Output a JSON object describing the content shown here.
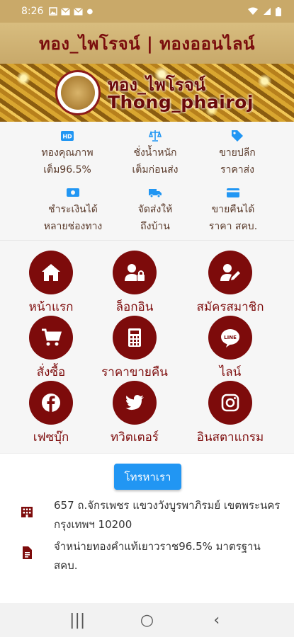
{
  "status_bar": {
    "time": "8:26",
    "notification_icons": [
      "gallery-icon",
      "mail-icon",
      "mail-icon",
      "dot-icon"
    ],
    "right_icons": [
      "wifi-icon",
      "signal-icon",
      "battery-icon"
    ]
  },
  "header": {
    "title": "ทอง_ไพโรจน์ | ทองออนไลน์"
  },
  "banner": {
    "title_thai": "ทอง_ไพโรจน์",
    "title_en": "Thong_phairoj"
  },
  "features": [
    {
      "icon": "hd-quality-icon",
      "line1": "ทองคุณภาพ",
      "line2": "เต็ม96.5%"
    },
    {
      "icon": "scale-icon",
      "line1": "ชั่งน้ำหนัก",
      "line2": "เต็มก่อนส่ง"
    },
    {
      "icon": "tag-icon",
      "line1": "ขายปลีก",
      "line2": "ราคาส่ง"
    },
    {
      "icon": "money-icon",
      "line1": "ชำระเงินได้",
      "line2": "หลายช่องทาง"
    },
    {
      "icon": "truck-icon",
      "line1": "จัดส่งให้",
      "line2": "ถึงบ้าน"
    },
    {
      "icon": "card-icon",
      "line1": "ขายคืนได้",
      "line2": "ราคา สคบ."
    }
  ],
  "menu": [
    {
      "icon": "home-icon",
      "label": "หน้าแรก"
    },
    {
      "icon": "user-lock-icon",
      "label": "ล็อกอิน"
    },
    {
      "icon": "user-edit-icon",
      "label": "สมัครสมาชิก"
    },
    {
      "icon": "cart-icon",
      "label": "สั่งซื้อ"
    },
    {
      "icon": "calculator-icon",
      "label": "ราคาขายคืน"
    },
    {
      "icon": "line-icon",
      "label": "ไลน์"
    },
    {
      "icon": "facebook-icon",
      "label": "เฟซบุ๊ก"
    },
    {
      "icon": "twitter-icon",
      "label": "ทวิตเตอร์"
    },
    {
      "icon": "instagram-icon",
      "label": "อินสตาแกรม"
    }
  ],
  "contact": {
    "button_label": "โทรหาเรา",
    "address_icon": "building-icon",
    "address": "657 ถ.จักรเพชร แขวงวังบูรพาภิรมย์ เขตพระนคร กรุงเทพฯ 10200",
    "description_icon": "document-icon",
    "description": "จำหน่ายทองคำแท้เยาวราช96.5% มาตรฐาน สคบ."
  },
  "nav_bar": {
    "recent_symbol": "|||",
    "home_symbol": "○",
    "back_symbol": "‹"
  },
  "colors": {
    "header_gold": "#c9a969",
    "brand_maroon": "#7d0b0b",
    "accent_blue": "#2196f3"
  }
}
